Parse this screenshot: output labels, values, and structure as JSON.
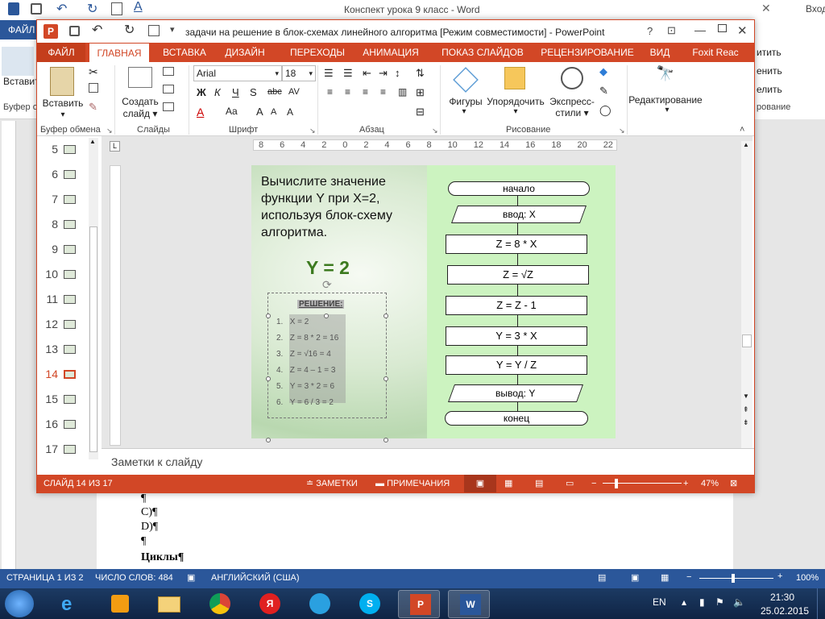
{
  "word": {
    "title": "Конспект урока 9 класс - Word",
    "login": "Вход",
    "file_tab": "ФАЙЛ",
    "paste_label": "Вставить",
    "clipboard_group": "Буфер о",
    "right_items": [
      "итить",
      "енить",
      "елить",
      "рование"
    ],
    "doc_lines": [
      "¶",
      "C)¶",
      "D)¶",
      "¶",
      "Циклы¶"
    ],
    "status": {
      "page": "СТРАНИЦА 1 ИЗ 2",
      "words": "ЧИСЛО СЛОВ: 484",
      "language": "АНГЛИЙСКИЙ (США)",
      "zoom": "100%"
    }
  },
  "ppt": {
    "title": "задачи на решение в блок-схемах линейного алгоритма [Режим совместимости] - PowerPoint",
    "help": "?",
    "tabs": [
      "ФАЙЛ",
      "ГЛАВНАЯ",
      "ВСТАВКА",
      "ДИЗАЙН",
      "ПЕРЕХОДЫ",
      "АНИМАЦИЯ",
      "ПОКАЗ СЛАЙДОВ",
      "РЕЦЕНЗИРОВАНИЕ",
      "ВИД",
      "Foxit Reac"
    ],
    "ribbon": {
      "paste": "Вставить",
      "create_slide_1": "Создать",
      "create_slide_2": "слайд",
      "font": "Arial",
      "size": "18",
      "shapes": "Фигуры",
      "arrange": "Упорядочить",
      "quick_styles_1": "Экспресс-",
      "quick_styles_2": "стили",
      "editing": "Редактирование",
      "groups": [
        "Буфер обмена",
        "Слайды",
        "Шрифт",
        "Абзац",
        "Рисование"
      ]
    },
    "thumbs": [
      {
        "n": "5"
      },
      {
        "n": "6"
      },
      {
        "n": "7"
      },
      {
        "n": "8"
      },
      {
        "n": "9"
      },
      {
        "n": "10"
      },
      {
        "n": "11"
      },
      {
        "n": "12"
      },
      {
        "n": "13"
      },
      {
        "n": "14"
      },
      {
        "n": "15"
      },
      {
        "n": "16"
      },
      {
        "n": "17"
      }
    ],
    "ruler": [
      "8",
      "6",
      "4",
      "2",
      "0",
      "2",
      "4",
      "6",
      "8",
      "10",
      "12",
      "14",
      "16",
      "18",
      "20",
      "22"
    ],
    "notes_placeholder": "Заметки к слайду",
    "status": {
      "slide": "СЛАЙД 14 ИЗ 17",
      "notes": "ЗАМЕТКИ",
      "comments": "ПРИМЕЧАНИЯ",
      "zoom": "47%"
    }
  },
  "slide": {
    "task": "Вычислите значение функции Y  при X=2, используя блок-схему алгоритма.",
    "answer": "Y = 2",
    "solution_title": "РЕШЕНИЕ:",
    "steps": [
      "X = 2",
      "Z = 8 * 2 = 16",
      "Z = √16 = 4",
      "Z = 4 – 1 = 3",
      "Y = 3 * 2 = 6",
      "Y = 6 / 3 = 2"
    ],
    "flow": {
      "start": "начало",
      "input": "ввод: X",
      "s1": "Z = 8 * X",
      "s2": "Z = √Z",
      "s3": "Z = Z - 1",
      "s4": "Y = 3 * X",
      "s5": "Y = Y / Z",
      "output": "вывод: Y",
      "end": "конец"
    }
  },
  "taskbar": {
    "lang": "EN",
    "time": "21:30",
    "date": "25.02.2015"
  }
}
